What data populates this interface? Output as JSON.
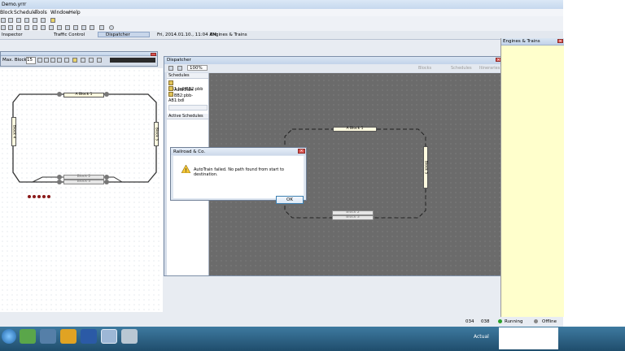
{
  "app": {
    "title": "Demo.yrrr"
  },
  "menu": [
    "Block",
    "Schedule",
    "Tools",
    "Window",
    "Help"
  ],
  "tabs": {
    "inspector": "Inspector",
    "traffic": "Traffic Control",
    "dispatcher": "Dispatcher",
    "datetime": "Fri, 2014.01.10., 11:04 AM",
    "engines": "Engines & Trains"
  },
  "left_panel": {
    "max_blocks_label": "Max. Blocks:",
    "max_blocks_value": "15"
  },
  "left_layout": {
    "a_block": "A Block 1",
    "block4": "Block 4",
    "block5": "Block 5",
    "block2": "Block 2",
    "block3": "Block 3"
  },
  "dispatcher": {
    "title": "Dispatcher",
    "zoom": "100%",
    "schedules_header": "Schedules",
    "schedules": [
      "AB1:bdl/BB2:pbb",
      "AutoTrain",
      "BB2:pbb-AB1:bdl"
    ],
    "active_schedules_header": "Active Schedules",
    "filters": {
      "blocks": "Blocks",
      "schedules": "Schedules",
      "itineraries": "Itineraries"
    },
    "layout": {
      "a_block": "A Block 1",
      "block5": "Block 5",
      "block2": "Block 2",
      "block3": "Block 3"
    }
  },
  "engines_panel": {
    "title": "Engines & Trains"
  },
  "dialog": {
    "title": "Railroad & Co.",
    "message": "AutoTrain failed. No path found from start to destination.",
    "ok": "OK"
  },
  "status": {
    "n1": "034",
    "n2": "038",
    "running": "Running",
    "offline": "Offline"
  },
  "taskbar": {
    "actual": "Actual"
  }
}
